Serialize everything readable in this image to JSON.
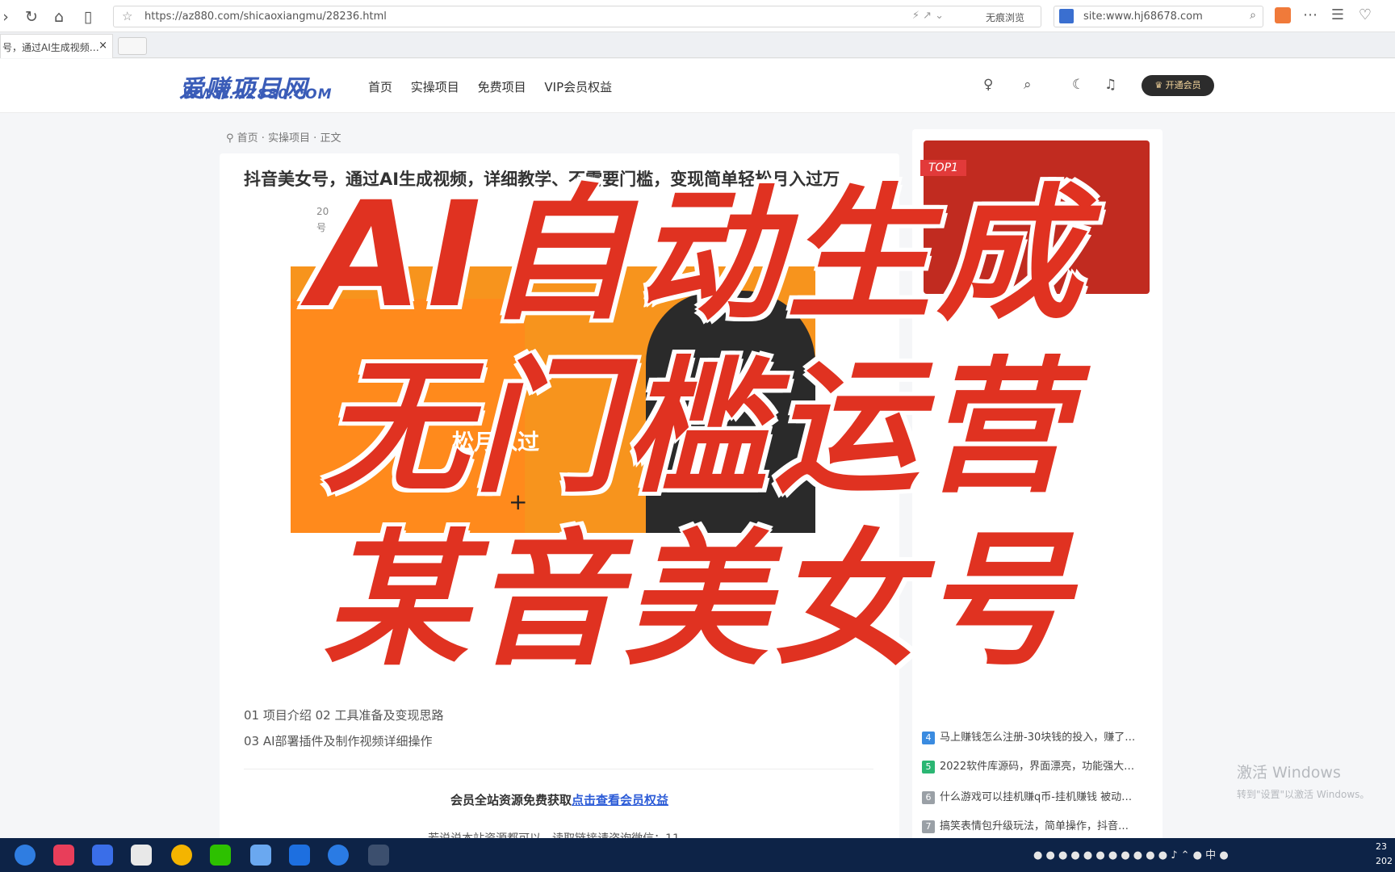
{
  "browser": {
    "url": "https://az880.com/shicaoxiangmu/28236.html",
    "mode_label": "无痕浏览",
    "search_query": "site:www.hj68678.com",
    "tab_title": "号，通过AI生成视频…",
    "tab_close": "×"
  },
  "site": {
    "logo_cn": "爱赚项目网",
    "logo_en": "WWW.AZ880.COM",
    "nav": [
      "首页",
      "实操项目",
      "免费项目",
      "VIP会员权益"
    ],
    "vip_button": "开通会员"
  },
  "breadcrumb": "首页 · 实操项目 · 正文",
  "article": {
    "title": "抖音美女号，通过AI生成视频，详细教学、不需要门槛，变现简单轻松月入过万",
    "meta_1": "20",
    "meta_2": "号",
    "cover_text": "松月入过",
    "cover_plus": "+",
    "outline_1": "01 项目介绍  02 工具准备及变现思路",
    "outline_2": "03 AI部署插件及制作视频详细操作",
    "member_prefix": "会员全站资源免费获取",
    "member_link": "点击查看会员权益",
    "cut_line": "若说说本站资源都可以，读取链接请咨询微信：11…"
  },
  "sidebar": {
    "top_badge": "TOP1",
    "hot_list": [
      {
        "num": "4",
        "text": "马上赚钱怎么注册-30块钱的投入，赚了…",
        "color": "#3a8be0"
      },
      {
        "num": "5",
        "text": "2022软件库源码，界面漂亮，功能强大…",
        "color": "#2bb673"
      },
      {
        "num": "6",
        "text": "什么游戏可以挂机赚q币-挂机赚钱 被动…",
        "color": "#9aa0a6"
      },
      {
        "num": "7",
        "text": "搞笑表情包升级玩法，简单操作，抖音…",
        "color": "#9aa0a6"
      }
    ]
  },
  "overlay": {
    "line1": "AI自动生成",
    "line2": "无门槛运营",
    "line3": "某音美女号"
  },
  "windows": {
    "activate_title": "激活 Windows",
    "activate_sub": "转到\"设置\"以激活 Windows。",
    "clock_time": "23",
    "clock_date": "202",
    "ime": "中"
  }
}
